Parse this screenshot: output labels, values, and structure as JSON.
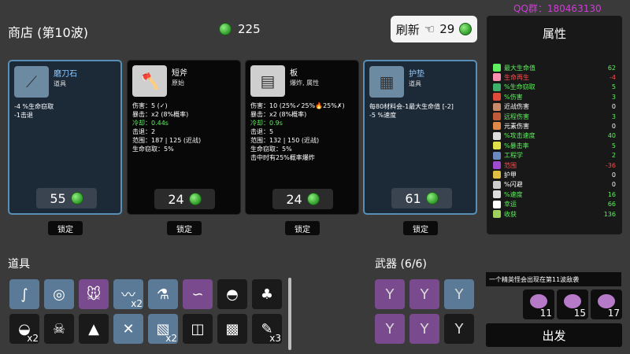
{
  "header": {
    "title": "商店 (第10波)",
    "materials": "225"
  },
  "reroll": {
    "label": "刷新",
    "cost": "29"
  },
  "watermark": "QQ群：180463130",
  "cards": [
    {
      "type": "item",
      "name": "磨刀石",
      "sub": "道具",
      "lines": [
        {
          "text": "-4 %生命窃取",
          "cls": ""
        },
        {
          "text": "-1击退",
          "cls": ""
        }
      ],
      "price": "55",
      "lock": "锁定",
      "icon": "whetstone-icon"
    },
    {
      "type": "weapon",
      "name": "短斧",
      "sub": "原始",
      "lines": [
        {
          "text": "伤害：5 (✓)",
          "cls": ""
        },
        {
          "text": "暴击：x2 (8%概率)",
          "cls": ""
        },
        {
          "text": "冷却：0.44s",
          "cls": "grn"
        },
        {
          "text": "击退：2",
          "cls": ""
        },
        {
          "text": "范围：187 | 125 (近战)",
          "cls": ""
        },
        {
          "text": "生命窃取：5%",
          "cls": ""
        }
      ],
      "price": "24",
      "lock": "锁定",
      "icon": "axe-icon"
    },
    {
      "type": "weapon",
      "name": "板",
      "sub": "爆炸, 属性",
      "lines": [
        {
          "text": "伤害：10 (25%✓25%🔥25%✗)",
          "cls": ""
        },
        {
          "text": "暴击：x2 (8%概率)",
          "cls": ""
        },
        {
          "text": "冷却：0.9s",
          "cls": "grn"
        },
        {
          "text": "击退：5",
          "cls": ""
        },
        {
          "text": "范围：132 | 150 (近战)",
          "cls": ""
        },
        {
          "text": "生命窃取：5%",
          "cls": ""
        },
        {
          "text": "击中时有25%概率爆炸",
          "cls": ""
        }
      ],
      "price": "24",
      "lock": "锁定",
      "icon": "plank-icon"
    },
    {
      "type": "item",
      "name": "护垫",
      "sub": "道具",
      "lines": [
        {
          "text": "每80材料会-1最大生命值 [-2]",
          "cls": ""
        },
        {
          "text": "-5 %速度",
          "cls": ""
        }
      ],
      "price": "61",
      "lock": "锁定",
      "icon": "padding-icon"
    }
  ],
  "stats_panel": {
    "title": "属性",
    "rows": [
      {
        "label": "最大生命值",
        "value": "62",
        "color": "#5ff05f",
        "icon_color": "#5ff05f"
      },
      {
        "label": "生命再生",
        "value": "-4",
        "color": "#ff4a4a",
        "icon_color": "#ff8fb0"
      },
      {
        "label": "%生命窃取",
        "value": "5",
        "color": "#5ff05f",
        "icon_color": "#3fb06a"
      },
      {
        "label": "%伤害",
        "value": "3",
        "color": "#5ff05f",
        "icon_color": "#e04a3a"
      },
      {
        "label": "近战伤害",
        "value": "0",
        "color": "#ffffff",
        "icon_color": "#c98a6a"
      },
      {
        "label": "远程伤害",
        "value": "3",
        "color": "#5ff05f",
        "icon_color": "#c05a3a"
      },
      {
        "label": "元素伤害",
        "value": "0",
        "color": "#ffffff",
        "icon_color": "#e08a4a"
      },
      {
        "label": "%攻击速度",
        "value": "40",
        "color": "#5ff05f",
        "icon_color": "#dcdcdc"
      },
      {
        "label": "%暴击率",
        "value": "5",
        "color": "#5ff05f",
        "icon_color": "#e0e04a"
      },
      {
        "label": "工程学",
        "value": "2",
        "color": "#5ff05f",
        "icon_color": "#6a8ac0"
      },
      {
        "label": "范围",
        "value": "-36",
        "color": "#ff4a4a",
        "icon_color": "#a04ad0"
      },
      {
        "label": "护甲",
        "value": "0",
        "color": "#ffffff",
        "icon_color": "#e0c040"
      },
      {
        "label": "%闪避",
        "value": "0",
        "color": "#ffffff",
        "icon_color": "#cccccc"
      },
      {
        "label": "%速度",
        "value": "16",
        "color": "#5ff05f",
        "icon_color": "#dddddd"
      },
      {
        "label": "幸运",
        "value": "66",
        "color": "#5ff05f",
        "icon_color": "#ffffff"
      },
      {
        "label": "收获",
        "value": "136",
        "color": "#5ff05f",
        "icon_color": "#a0d060"
      }
    ]
  },
  "items_section": {
    "label": "道具"
  },
  "items": [
    {
      "icon": "pipe-icon",
      "bg": "#5a7a98",
      "count": ""
    },
    {
      "icon": "amulet-icon",
      "bg": "#5a7a98",
      "count": ""
    },
    {
      "icon": "mouse-icon",
      "bg": "#7a4a8e",
      "count": ""
    },
    {
      "icon": "worm-icon",
      "bg": "#5a7a98",
      "count": "x2"
    },
    {
      "icon": "potion-icon",
      "bg": "#5a7a98",
      "count": ""
    },
    {
      "icon": "scarf-icon",
      "bg": "#7a4a8e",
      "count": ""
    },
    {
      "icon": "propeller-hat-icon",
      "bg": "#1a1a1a",
      "count": ""
    },
    {
      "icon": "tree-icon",
      "bg": "#1a1a1a",
      "count": ""
    },
    {
      "icon": "helmet-icon",
      "bg": "#1a1a1a",
      "count": "x2"
    },
    {
      "icon": "skull-icon",
      "bg": "#1a1a1a",
      "count": ""
    },
    {
      "icon": "cloak-icon",
      "bg": "#1a1a1a",
      "count": ""
    },
    {
      "icon": "tools-icon",
      "bg": "#5a7a98",
      "count": ""
    },
    {
      "icon": "map-icon",
      "bg": "#5a7a98",
      "count": "x2"
    },
    {
      "icon": "bucket-icon",
      "bg": "#1a1a1a",
      "count": ""
    },
    {
      "icon": "vest-icon",
      "bg": "#1a1a1a",
      "count": ""
    },
    {
      "icon": "scroll-icon",
      "bg": "#1a1a1a",
      "count": "x3"
    }
  ],
  "weapons_section": {
    "label": "武器 (6/6)"
  },
  "weapons": [
    {
      "icon": "slingshot-icon",
      "bg": "#7a4a8e"
    },
    {
      "icon": "slingshot-icon",
      "bg": "#7a4a8e"
    },
    {
      "icon": "slingshot-icon",
      "bg": "#5a7a98"
    },
    {
      "icon": "slingshot-icon",
      "bg": "#7a4a8e"
    },
    {
      "icon": "slingshot-icon",
      "bg": "#7a4a8e"
    },
    {
      "icon": "slingshot-icon",
      "bg": "#1a1a1a"
    }
  ],
  "wave_info": "一个精英怪会出现在第11波敌袭",
  "elites": [
    "11",
    "15",
    "17"
  ],
  "go_button": "出发"
}
